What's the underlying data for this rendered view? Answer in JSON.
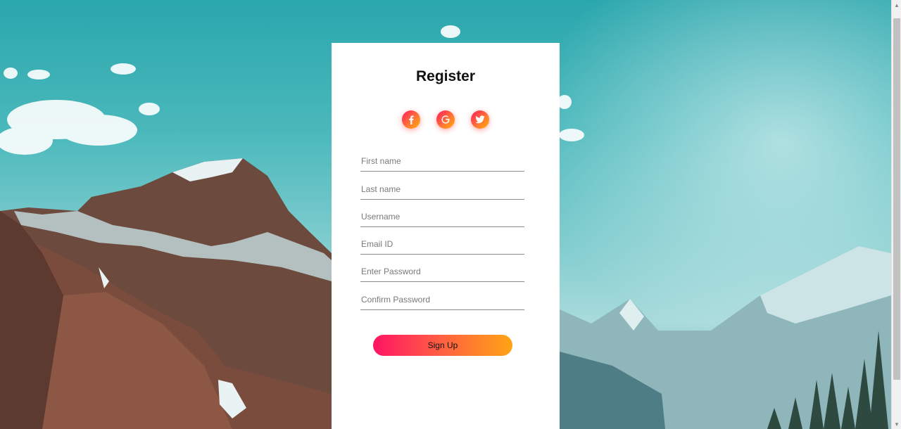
{
  "page": {
    "title": "Register"
  },
  "social": [
    {
      "name": "facebook-icon",
      "glyph": "f"
    },
    {
      "name": "google-icon",
      "glyph": "G"
    },
    {
      "name": "twitter-icon",
      "glyph": "bird"
    }
  ],
  "form": {
    "fields": [
      {
        "key": "first_name",
        "placeholder": "First name",
        "value": ""
      },
      {
        "key": "last_name",
        "placeholder": "Last name",
        "value": ""
      },
      {
        "key": "username",
        "placeholder": "Username",
        "value": ""
      },
      {
        "key": "email",
        "placeholder": "Email ID",
        "value": ""
      },
      {
        "key": "password",
        "placeholder": "Enter Password",
        "value": ""
      },
      {
        "key": "confirm_password",
        "placeholder": "Confirm Password",
        "value": ""
      }
    ],
    "submit_label": "Sign Up"
  },
  "colors": {
    "accent_start": "#ff1464",
    "accent_end": "#ffa414",
    "card_bg": "#ffffff",
    "sky": "#2aa7ad"
  }
}
